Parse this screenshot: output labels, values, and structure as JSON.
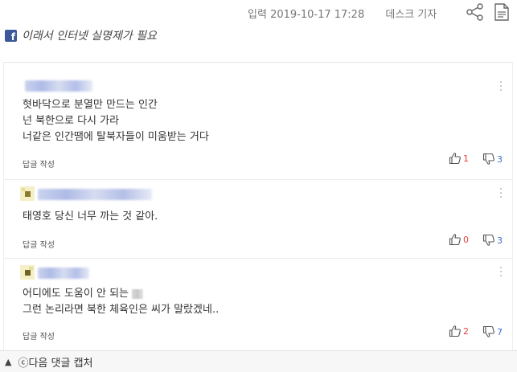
{
  "header": {
    "input_label": "입력",
    "datetime": "2019-10-17 17:28",
    "reporter": "데스크 기자"
  },
  "facebook": {
    "title": "이래서 인터넷 실명제가 필요"
  },
  "comments": [
    {
      "lines": [
        "혓바닥으로 분열만 만드는 인간",
        "넌 북한으로 다시 가라",
        "너같은 인간땜에 탈북자들이 미움받는 거다"
      ],
      "reply_label": "답글 작성",
      "likes": "1",
      "dislikes": "3"
    },
    {
      "lines": [
        "태영호 당신 너무 까는 것 같아."
      ],
      "reply_label": "답글 작성",
      "likes": "0",
      "dislikes": "3"
    },
    {
      "lines": [
        "어디에도 도움이 안 되는",
        "그런 논리라면 북한 체육인은 씨가 말랐겠네.."
      ],
      "reply_label": "답글 작성",
      "likes": "2",
      "dislikes": "7"
    }
  ],
  "footer": {
    "toggle_icon": "triangle-up-icon",
    "label": "ⓒ다음 댓글 캡처"
  },
  "colors": {
    "like": "#e0413c",
    "dislike": "#3a6fd0",
    "facebook": "#3b5998"
  }
}
